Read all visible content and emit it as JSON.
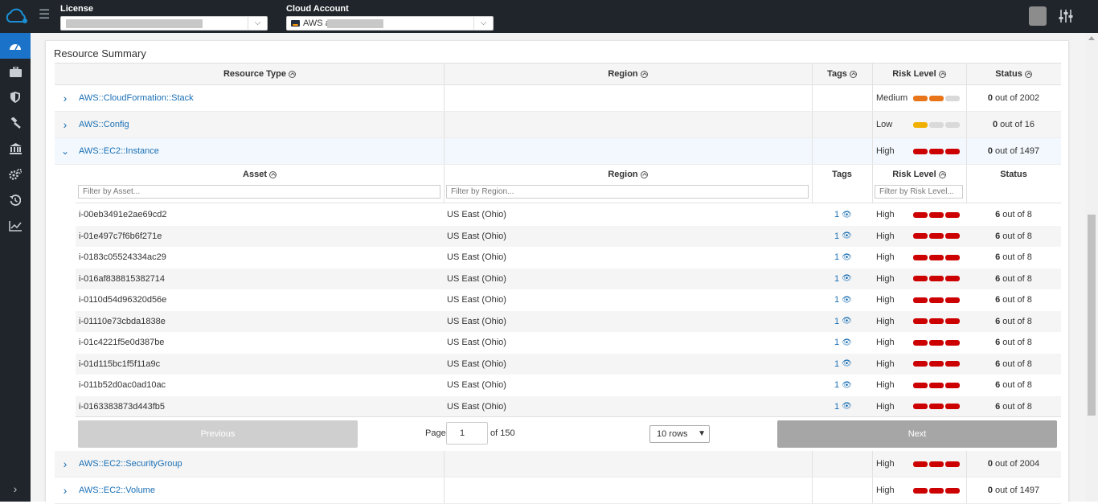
{
  "header": {
    "license_label": "License",
    "cloud_account_label": "Cloud Account",
    "cloud_account_value": "AWS a"
  },
  "sidebar": {
    "items": [
      {
        "icon": "dashboard-icon",
        "active": true
      },
      {
        "icon": "briefcase-icon",
        "active": false
      },
      {
        "icon": "shield-icon",
        "active": false
      },
      {
        "icon": "gavel-icon",
        "active": false
      },
      {
        "icon": "bank-icon",
        "active": false
      },
      {
        "icon": "gears-icon",
        "active": false
      },
      {
        "icon": "history-icon",
        "active": false
      },
      {
        "icon": "trend-chart-icon",
        "active": false
      }
    ]
  },
  "summary": {
    "title": "Resource Summary",
    "columns": {
      "resource_type": "Resource Type",
      "region": "Region",
      "tags": "Tags",
      "risk_level": "Risk Level",
      "status": "Status"
    },
    "rows": [
      {
        "type": "AWS::CloudFormation::Stack",
        "risk": "Medium",
        "risk_level": 2,
        "risk_color": "#e8751a",
        "status_num": "0",
        "status_rest": "out of 2002"
      },
      {
        "type": "AWS::Config",
        "risk": "Low",
        "risk_level": 1,
        "risk_color": "#f0b000",
        "status_num": "0",
        "status_rest": "out of 16"
      },
      {
        "type": "AWS::EC2::Instance",
        "risk": "High",
        "risk_level": 3,
        "risk_color": "#cc0000",
        "status_num": "0",
        "status_rest": "out of 1497"
      },
      {
        "type": "AWS::EC2::SecurityGroup",
        "risk": "High",
        "risk_level": 3,
        "risk_color": "#cc0000",
        "status_num": "0",
        "status_rest": "out of 2004"
      },
      {
        "type": "AWS::EC2::Volume",
        "risk": "High",
        "risk_level": 3,
        "risk_color": "#cc0000",
        "status_num": "0",
        "status_rest": "out of 1497"
      }
    ]
  },
  "assets": {
    "columns": {
      "asset": "Asset",
      "region": "Region",
      "tags": "Tags",
      "risk_level": "Risk Level",
      "status": "Status"
    },
    "filters": {
      "asset": "Filter by Asset...",
      "region": "Filter by Region...",
      "risk": "Filter by Risk Level..."
    },
    "rows": [
      {
        "asset": "i-00eb3491e2ae69cd2",
        "region": "US East (Ohio)",
        "tags": "1",
        "risk": "High",
        "status_num": "6",
        "status_rest": "out of 8"
      },
      {
        "asset": "i-01e497c7f6b6f271e",
        "region": "US East (Ohio)",
        "tags": "1",
        "risk": "High",
        "status_num": "6",
        "status_rest": "out of 8"
      },
      {
        "asset": "i-0183c05524334ac29",
        "region": "US East (Ohio)",
        "tags": "1",
        "risk": "High",
        "status_num": "6",
        "status_rest": "out of 8"
      },
      {
        "asset": "i-016af838815382714",
        "region": "US East (Ohio)",
        "tags": "1",
        "risk": "High",
        "status_num": "6",
        "status_rest": "out of 8"
      },
      {
        "asset": "i-0110d54d96320d56e",
        "region": "US East (Ohio)",
        "tags": "1",
        "risk": "High",
        "status_num": "6",
        "status_rest": "out of 8"
      },
      {
        "asset": "i-01110e73cbda1838e",
        "region": "US East (Ohio)",
        "tags": "1",
        "risk": "High",
        "status_num": "6",
        "status_rest": "out of 8"
      },
      {
        "asset": "i-01c4221f5e0d387be",
        "region": "US East (Ohio)",
        "tags": "1",
        "risk": "High",
        "status_num": "6",
        "status_rest": "out of 8"
      },
      {
        "asset": "i-01d115bc1f5f11a9c",
        "region": "US East (Ohio)",
        "tags": "1",
        "risk": "High",
        "status_num": "6",
        "status_rest": "out of 8"
      },
      {
        "asset": "i-011b52d0ac0ad10ac",
        "region": "US East (Ohio)",
        "tags": "1",
        "risk": "High",
        "status_num": "6",
        "status_rest": "out of 8"
      },
      {
        "asset": "i-0163383873d443fb5",
        "region": "US East (Ohio)",
        "tags": "1",
        "risk": "High",
        "status_num": "6",
        "status_rest": "out of 8"
      }
    ],
    "risk_level": 3,
    "risk_color": "#cc0000"
  },
  "pagination": {
    "previous": "Previous",
    "next": "Next",
    "page_label": "Page",
    "page_value": "1",
    "of_label": "of 150",
    "rows_option": "10 rows"
  }
}
